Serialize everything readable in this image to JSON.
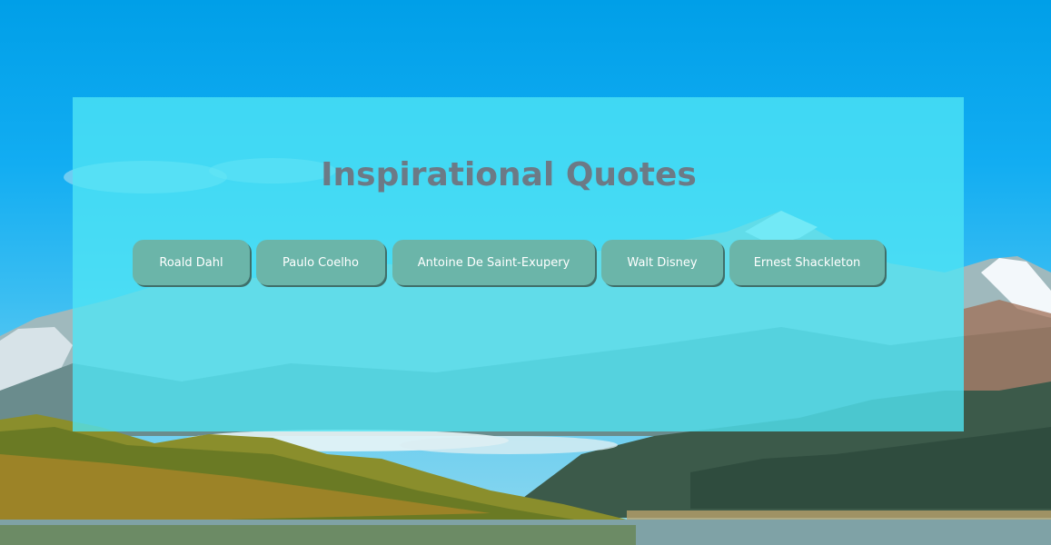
{
  "page": {
    "title": "Inspirational Quotes"
  },
  "authors": [
    {
      "label": "Roald Dahl"
    },
    {
      "label": "Paulo Coelho"
    },
    {
      "label": "Antoine De Saint-Exupery"
    },
    {
      "label": "Walt Disney"
    },
    {
      "label": "Ernest Shackleton"
    }
  ],
  "colors": {
    "panel_overlay": "#50e6f5",
    "title_text": "#6c7a86",
    "button_bg": "#6bb5a9",
    "button_shadow": "#3f6f6a",
    "button_text": "#ffffff",
    "sky": "#009fe8"
  }
}
